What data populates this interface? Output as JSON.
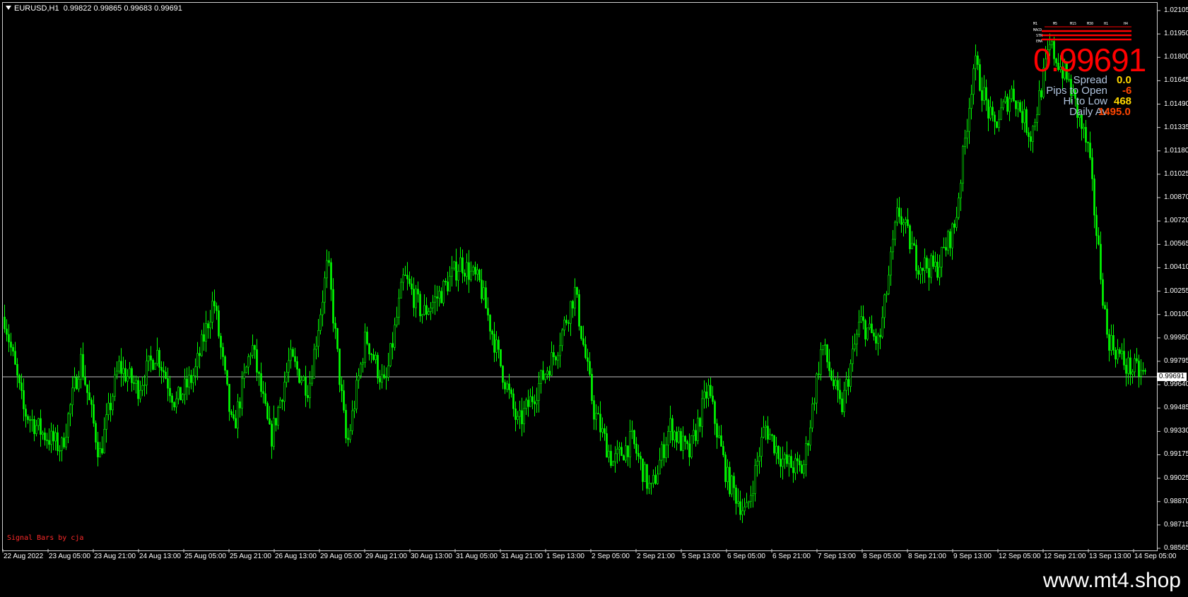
{
  "chart_header": {
    "symbol": "EURUSD,H1",
    "ohlc": "0.99822 0.99865 0.99683 0.99691"
  },
  "price_axis": {
    "labels": [
      "1.02105",
      "1.01950",
      "1.01800",
      "1.01645",
      "1.01490",
      "1.01335",
      "1.01180",
      "1.01025",
      "1.00870",
      "1.00720",
      "1.00565",
      "1.00410",
      "1.00255",
      "1.00100",
      "0.99950",
      "0.99795",
      "0.99640",
      "0.99485",
      "0.99330",
      "0.99175",
      "0.99025",
      "0.98870",
      "0.98715",
      "0.98565"
    ]
  },
  "current_price_tag": "0.99691",
  "time_axis": {
    "labels": [
      "22 Aug 2022",
      "23 Aug 05:00",
      "23 Aug 21:00",
      "24 Aug 13:00",
      "25 Aug 05:00",
      "25 Aug 21:00",
      "26 Aug 13:00",
      "29 Aug 05:00",
      "29 Aug 21:00",
      "30 Aug 13:00",
      "31 Aug 05:00",
      "31 Aug 21:00",
      "1 Sep 13:00",
      "2 Sep 05:00",
      "2 Sep 21:00",
      "5 Sep 13:00",
      "6 Sep 05:00",
      "6 Sep 21:00",
      "7 Sep 13:00",
      "8 Sep 05:00",
      "8 Sep 21:00",
      "9 Sep 13:00",
      "12 Sep 05:00",
      "12 Sep 21:00",
      "13 Sep 13:00",
      "14 Sep 05:00"
    ]
  },
  "signal_bars": {
    "timeframes": [
      "M1",
      "M5",
      "M15",
      "M30",
      "H1",
      "H4"
    ],
    "rows": [
      "MACD",
      "STR",
      "EMA"
    ],
    "signal_color": "#ff0000"
  },
  "price_panel": {
    "price": "0.99691",
    "price_color": "#ff0000",
    "rows": [
      {
        "label": "Spread",
        "value": "0.0",
        "color": "#ffd700"
      },
      {
        "label": "Pips to Open",
        "value": "-6",
        "color": "#ff4500"
      },
      {
        "label": "Hi to Low",
        "value": "468",
        "color": "#ffd700"
      },
      {
        "label": "Daily Av",
        "value": "1495.0",
        "color": "#ff4500"
      }
    ]
  },
  "credit_text": "Signal Bars by cja",
  "watermark": "www.mt4.shop",
  "chart_data": {
    "type": "candlestick",
    "symbol": "EURUSD",
    "timeframe": "H1",
    "x": [
      "22 Aug 2022",
      "23 Aug 05:00",
      "23 Aug 21:00",
      "24 Aug 13:00",
      "25 Aug 05:00",
      "25 Aug 21:00",
      "26 Aug 13:00",
      "29 Aug 05:00",
      "29 Aug 21:00",
      "30 Aug 13:00",
      "31 Aug 05:00",
      "31 Aug 21:00",
      "1 Sep 13:00",
      "2 Sep 05:00",
      "2 Sep 21:00",
      "5 Sep 13:00",
      "6 Sep 05:00",
      "6 Sep 21:00",
      "7 Sep 13:00",
      "8 Sep 05:00",
      "8 Sep 21:00",
      "9 Sep 13:00",
      "12 Sep 05:00",
      "12 Sep 21:00",
      "13 Sep 13:00",
      "14 Sep 05:00"
    ],
    "close_path": [
      1.0008,
      0.9945,
      0.993,
      0.992,
      0.998,
      0.9915,
      0.9975,
      0.996,
      0.9985,
      0.995,
      0.997,
      1.002,
      0.993,
      0.999,
      0.9925,
      0.998,
      0.996,
      1.0045,
      0.992,
      0.9995,
      0.996,
      1.0035,
      1.001,
      1.0025,
      1.0045,
      1.003,
      0.998,
      0.9935,
      0.996,
      0.9985,
      1.0025,
      0.9945,
      0.991,
      0.9925,
      0.989,
      0.9935,
      0.9915,
      0.996,
      0.99,
      0.9875,
      0.9935,
      0.991,
      0.9905,
      0.999,
      0.9945,
      1.0005,
      0.999,
      1.008,
      1.0045,
      1.004,
      1.007,
      1.018,
      1.0135,
      1.016,
      1.013,
      1.019,
      1.0165,
      1.012,
      0.9995,
      0.9975,
      0.9969
    ],
    "ylim": [
      0.98525,
      1.0214
    ],
    "last_price": 0.99691,
    "color": "#00ff00"
  }
}
